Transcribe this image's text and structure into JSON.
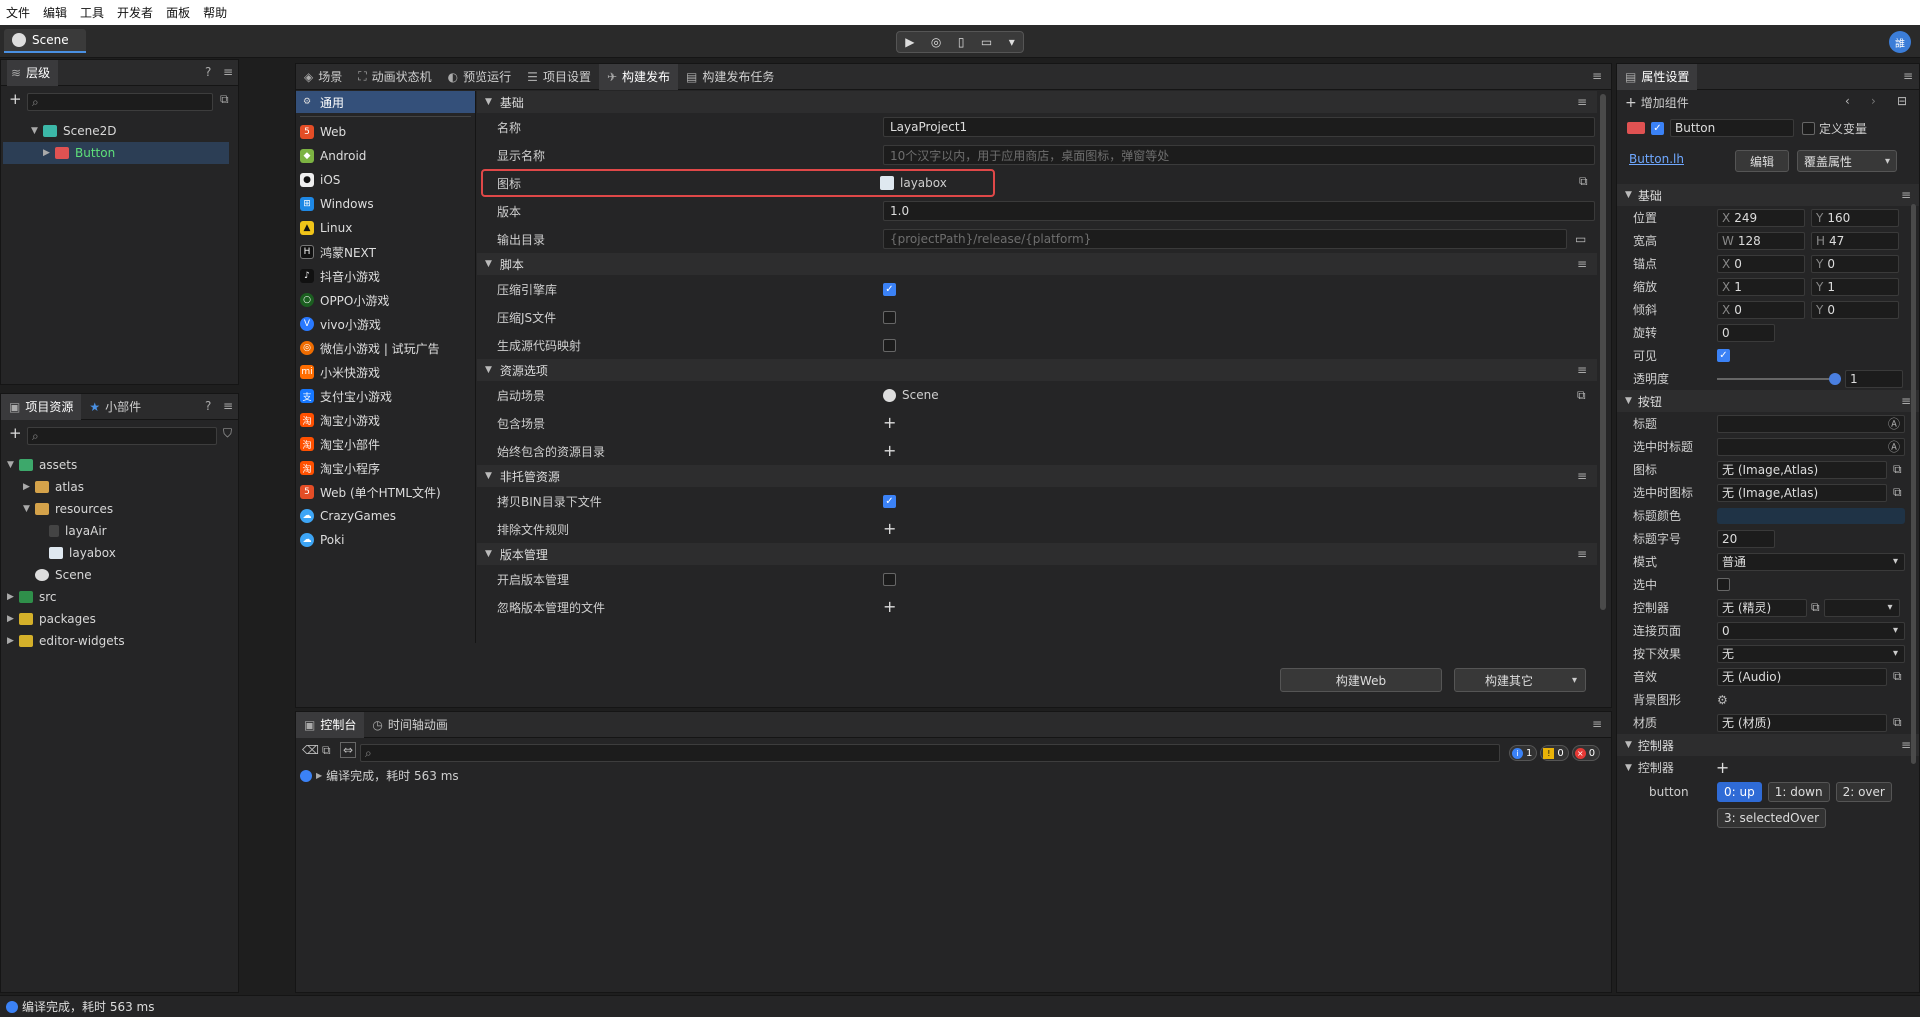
{
  "menubar": [
    "文件",
    "编辑",
    "工具",
    "开发者",
    "面板",
    "帮助"
  ],
  "scene_tab": "Scene",
  "user_initial": "誰",
  "hierarchy": {
    "title": "层级",
    "items": [
      {
        "label": "Scene2D"
      },
      {
        "label": "Button"
      }
    ]
  },
  "assets": {
    "tabs": [
      "项目资源",
      "小部件"
    ],
    "items": [
      "assets",
      "atlas",
      "resources",
      "layaAir",
      "layabox",
      "Scene",
      "src",
      "packages",
      "editor-widgets"
    ]
  },
  "main_tabs": [
    "场景",
    "动画状态机",
    "预览运行",
    "项目设置",
    "构建发布",
    "构建发布任务"
  ],
  "platforms": [
    "通用",
    "Web",
    "Android",
    "iOS",
    "Windows",
    "Linux",
    "鸿蒙NEXT",
    "抖音小游戏",
    "OPPO小游戏",
    "vivo小游戏",
    "微信小游戏 | 试玩广告",
    "小米快游戏",
    "支付宝小游戏",
    "淘宝小游戏",
    "淘宝小部件",
    "淘宝小程序",
    "Web (单个HTML文件)",
    "CrazyGames",
    "Poki"
  ],
  "build": {
    "sec_basic": "基础",
    "name_label": "名称",
    "name_value": "LayaProject1",
    "display_label": "显示名称",
    "display_placeholder": "10个汉字以内，用于应用商店，桌面图标，弹窗等处",
    "icon_label": "图标",
    "icon_value": "layabox",
    "version_label": "版本",
    "version_value": "1.0",
    "outdir_label": "输出目录",
    "outdir_placeholder": "{projectPath}/release/{platform}",
    "sec_script": "脚本",
    "compress_engine": "压缩引擎库",
    "compress_js": "压缩JS文件",
    "sourcemap": "生成源代码映射",
    "sec_res": "资源选项",
    "start_scene_label": "启动场景",
    "start_scene_value": "Scene",
    "include_scene": "包含场景",
    "always_include": "始终包含的资源目录",
    "sec_unmanaged": "非托管资源",
    "copy_bin": "拷贝BIN目录下文件",
    "exclude_rules": "排除文件规则",
    "sec_version": "版本管理",
    "enable_version": "开启版本管理",
    "ignore_version": "忽略版本管理的文件",
    "build_web": "构建Web",
    "build_other": "构建其它"
  },
  "console": {
    "tabs": [
      "控制台",
      "时间轴动画"
    ],
    "counts": {
      "info": "1",
      "warn": "0",
      "error": "0"
    },
    "message": "编译完成，耗时 563 ms"
  },
  "props": {
    "title": "属性设置",
    "add_component": "增加组件",
    "node_name": "Button",
    "define_var": "定义变量",
    "link": "Button.lh",
    "edit": "编辑",
    "override": "覆盖属性",
    "sec_basic": "基础",
    "position": {
      "label": "位置",
      "x": "249",
      "y": "160"
    },
    "size": {
      "label": "宽高",
      "w": "128",
      "h": "47"
    },
    "anchor": {
      "label": "锚点",
      "x": "0",
      "y": "0"
    },
    "scale": {
      "label": "缩放",
      "x": "1",
      "y": "1"
    },
    "skew": {
      "label": "倾斜",
      "x": "0",
      "y": "0"
    },
    "rotation": {
      "label": "旋转",
      "value": "0"
    },
    "visible": {
      "label": "可见"
    },
    "alpha": {
      "label": "透明度",
      "value": "1",
      "level": 1
    },
    "sec_button": "按钮",
    "title_label": "标题",
    "sel_title_label": "选中时标题",
    "icon_label": "图标",
    "icon_value": "无 (Image,Atlas)",
    "sel_icon_label": "选中时图标",
    "sel_icon_value": "无 (Image,Atlas)",
    "title_color_label": "标题颜色",
    "title_color": "#1f3346",
    "font_size_label": "标题字号",
    "font_size": "20",
    "mode_label": "模式",
    "mode_value": "普通",
    "selected_label": "选中",
    "controller_label": "控制器",
    "controller_value": "无 (精灵)",
    "link_page_label": "连接页面",
    "link_page_value": "0",
    "press_label": "按下效果",
    "press_value": "无",
    "sound_label": "音效",
    "sound_value": "无 (Audio)",
    "bg_label": "背景图形",
    "material_label": "材质",
    "material_value": "无 (材质)",
    "sec_controller": "控制器",
    "ctl_label": "控制器",
    "ctl_name": "button",
    "states": [
      "0: up",
      "1: down",
      "2: over",
      "3: selectedOver"
    ]
  },
  "status": "编译完成，耗时 563 ms"
}
